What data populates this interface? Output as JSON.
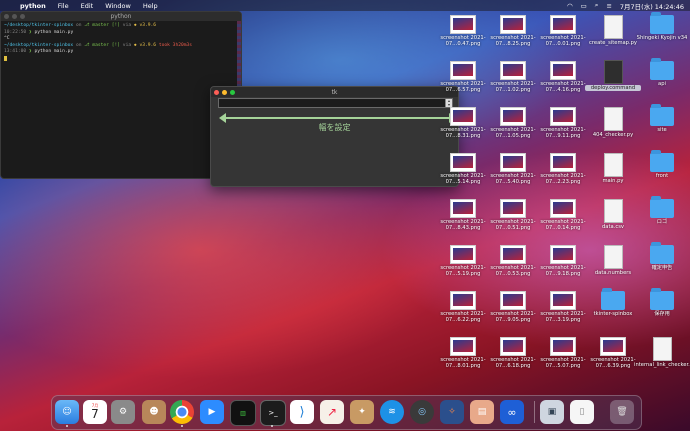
{
  "menubar": {
    "app": "python",
    "items": [
      "File",
      "Edit",
      "Window",
      "Help"
    ],
    "clock": "7月7日(水) 14:24:46"
  },
  "terminal": {
    "title": "python",
    "lines": [
      {
        "path": "~/desktop/tkinter-spinbox",
        "on": "on",
        "branch": "master [!]",
        "via": "via",
        "pyver": "v3.9.6",
        "extra": ""
      },
      {
        "time": "10:22:50",
        "cmd": "python main.py"
      },
      {
        "text": "^C"
      },
      {
        "path": "~/desktop/tkinter-spinbox",
        "on": "on",
        "branch": "master [!]",
        "via": "via",
        "pyver": "v3.9.6",
        "extra": "took 3h20m3s"
      },
      {
        "time": "13:41:00",
        "cmd": "python main.py"
      }
    ]
  },
  "tk": {
    "title": "tk",
    "label": "幅を設定"
  },
  "desktop": {
    "col1": [
      "screenshot 2021-07…0.47.png",
      "screenshot 2021-07…6.57.png",
      "screenshot 2021-07…8.31.png",
      "screenshot 2021-07…5.14.png",
      "screenshot 2021-07…8.43.png",
      "screenshot 2021-07…5.19.png",
      "screenshot 2021-07…6.22.png",
      "screenshot 2021-07…8.01.png"
    ],
    "col2": [
      "screenshot 2021-07…8.25.png",
      "screenshot 2021-07…1.02.png",
      "screenshot 2021-07…1.05.png",
      "screenshot 2021-07…5.40.png",
      "screenshot 2021-07…0.51.png",
      "screenshot 2021-07…0.53.png",
      "screenshot 2021-07…9.05.png",
      "screenshot 2021-07…6.18.png"
    ],
    "col3": [
      "screenshot 2021-07…0.01.png",
      "screenshot 2021-07…4.16.png",
      "screenshot 2021-07…9.11.png",
      "screenshot 2021-07…2.23.png",
      "screenshot 2021-07…0.14.png",
      "screenshot 2021-07…9.18.png",
      "screenshot 2021-07…3.19.png",
      "screenshot 2021-07…5.07.png"
    ],
    "col4": [
      "create_sitemap.py",
      "deploy.command",
      "",
      "404_checker.py",
      "main.py",
      "data.csv",
      "data.numbers",
      "tkinter-spinbox",
      "screenshot 2021-07…6.39.png"
    ],
    "col5": [
      "Shingeki Kyojin v34",
      "api",
      "site",
      "front",
      "ロゴ",
      "確定申告",
      "保存用",
      "internal_link_checker.py"
    ]
  },
  "dock": {
    "apps": [
      "Finder",
      "Calendar",
      "System Preferences",
      "Contacts",
      "Chrome",
      "Zoom",
      "Activity Monitor",
      "Terminal",
      "VS Code",
      "Grapher",
      "Preview",
      "Docker",
      "Safari",
      "Sourcetree",
      "Sequel",
      "Dropbox",
      "Screenshot",
      "Document",
      "Trash"
    ],
    "calendar_day": "7",
    "calendar_month": "7月"
  }
}
